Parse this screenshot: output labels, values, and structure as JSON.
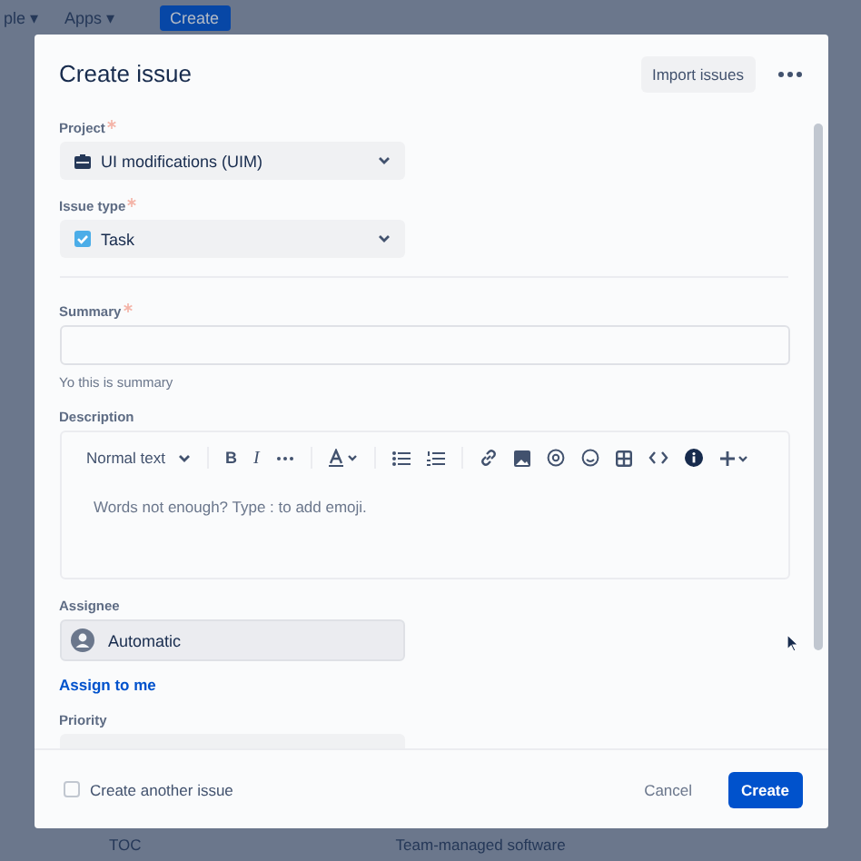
{
  "topbar": {
    "items": [
      "ple ▾",
      "Apps ▾"
    ],
    "create_button": "Create"
  },
  "modal": {
    "title": "Create issue",
    "import_button": "Import issues",
    "fields": [
      {
        "kind": "select",
        "label": "Project",
        "required": true,
        "value": {
          "kind": "project",
          "text": "UI modifications (UIM)"
        }
      },
      {
        "kind": "select",
        "label": "Issue type",
        "required": true,
        "value": {
          "kind": "task",
          "text": "Task"
        }
      },
      {
        "kind": "divider"
      },
      {
        "kind": "text",
        "label": "Summary",
        "required": true,
        "help": "Yo this is summary"
      },
      {
        "kind": "editor",
        "label": "Description",
        "required": false,
        "style_menu": "Normal text",
        "bold": "B",
        "italic": "I",
        "placeholder": "Words not enough? Type : to add emoji."
      },
      {
        "kind": "user",
        "label": "Assignee",
        "required": false,
        "value": "Automatic",
        "link": "Assign to me"
      },
      {
        "kind": "select",
        "label": "Priority",
        "required": false
      }
    ],
    "footer": {
      "checkbox": {
        "label": "Create another issue",
        "checked": false
      },
      "cancel": "Cancel",
      "create": "Create"
    }
  },
  "background_row": [
    "TOC",
    "Team-managed software"
  ]
}
